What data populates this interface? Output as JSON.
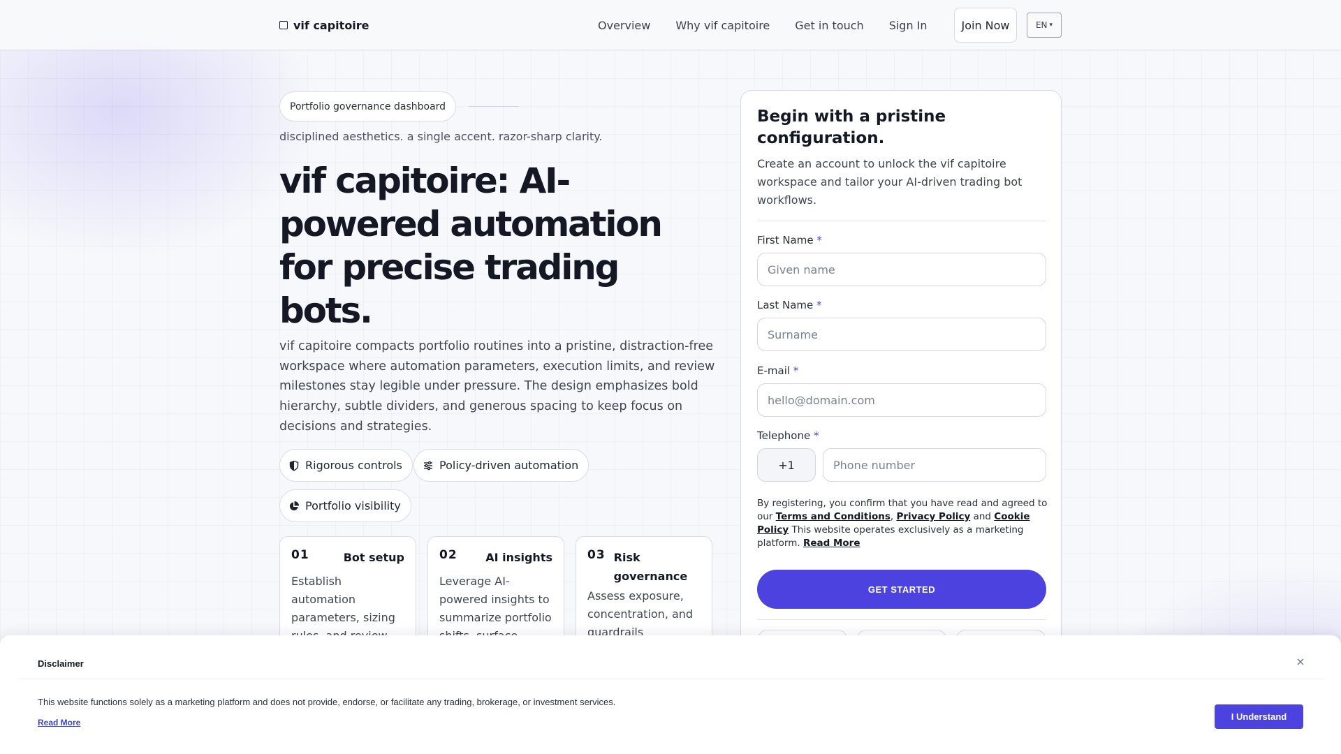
{
  "header": {
    "brand": "vif capitoire",
    "nav": [
      "Overview",
      "Why vif capitoire",
      "Get in touch",
      "Sign In"
    ],
    "join_label": "Join Now",
    "lang_label": "EN",
    "lang_caret": "▾"
  },
  "hero": {
    "badge": "Portfolio governance dashboard",
    "tagline": "disciplined aesthetics. a single accent. razor-sharp clarity.",
    "title": "vif capitoire: AI-powered automation for precise trading bots.",
    "description": "vif capitoire compacts portfolio routines into a pristine, distraction-free workspace where automation parameters, execution limits, and review milestones stay legible under pressure. The design emphasizes bold hier­archy, subtle dividers, and generous spacing to keep focus on decisions and strategies.",
    "chips": [
      {
        "label": "Rigorous controls",
        "icon": "shield-icon"
      },
      {
        "label": "Policy-driven automation",
        "icon": "sliders-icon"
      },
      {
        "label": "Portfolio visibility",
        "icon": "pie-chart-icon"
      }
    ],
    "steps": [
      {
        "num": "01",
        "title": "Bot setup",
        "body": "Establish automation parameters, sizing rules, and review ca­dence within a lay..."
      },
      {
        "num": "02",
        "title": "AI insights",
        "body": "Leverage AI-powered insights to summa­rize portfolio shifts, surface constraints..."
      },
      {
        "num": "03",
        "title": "Risk governance",
        "body": "Assess exposure, concentration, and guardrails through..."
      }
    ]
  },
  "form": {
    "title": "Begin with a pristine configuration.",
    "subtitle": "Create an account to unlock the vif capitoire workspace and tailor your AI-driven trading bot workflows.",
    "required_mark": "*",
    "first_name": {
      "label": "First Name",
      "placeholder": "Given name"
    },
    "last_name": {
      "label": "Last Name",
      "placeholder": "Surname"
    },
    "email": {
      "label": "E-mail",
      "placeholder": "hello@domain.com"
    },
    "phone": {
      "label": "Telephone",
      "code": "+1",
      "placeholder": "Phone number"
    },
    "consent": {
      "prefix": "By registering, you confirm that you have read and agreed to our ",
      "terms": "Terms and Conditions",
      "sep1": ", ",
      "privacy": "Privacy Policy",
      "sep2": " and ",
      "cookie": "Cookie Policy",
      "middle": " This website operates exclusively as a marketing platform. ",
      "read_more": "Read More"
    },
    "cta_label": "GET STARTED"
  },
  "disclaimer": {
    "title": "Disclaimer",
    "close": "×",
    "text": "This website functions solely as a marketing platform and does not provide, endorse, or facilitate any trading, brokerage, or investment services.",
    "read_more": "Read More",
    "button": "I Understand"
  },
  "colors": {
    "accent": "#4b42e0",
    "text_dark": "#141824",
    "border": "#d9dce4"
  }
}
